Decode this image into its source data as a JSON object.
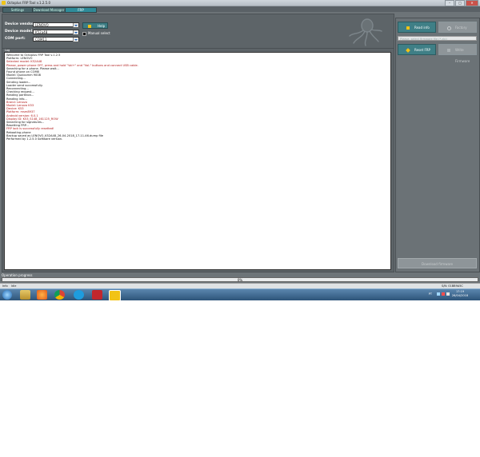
{
  "window": {
    "title": "Octoplus FRP Tool v.1.2.5.0",
    "min": "–",
    "max": "□",
    "close": "✕"
  },
  "tabs": [
    "Settings",
    "Download Manager",
    "FRP"
  ],
  "config": {
    "vendor_label": "Device vendor:",
    "vendor_value": "LENOVO",
    "model_label": "Device model:",
    "model_value": "K52a48",
    "port_label": "COM port:",
    "port_value": "COM11",
    "help_label": "Help",
    "manual_label": "Manual select"
  },
  "log": {
    "label": "Log",
    "lines": [
      {
        "text": "Welcome to Octoplus FRP Tool v.1.2.5",
        "color": "#111111"
      },
      {
        "text": "Platform: LENOVO",
        "color": "#111111"
      },
      {
        "text": "Selected model: K52A48",
        "color": "#b01818"
      },
      {
        "text": "Please, power phone OFF, press and hold \"Vol+\" and \"Vol-\" buttons and connect USB cable.",
        "color": "#b01818"
      },
      {
        "text": "Searching for a phone. Please wait...",
        "color": "#111111"
      },
      {
        "text": "Found phone on COM8",
        "color": "#111111"
      },
      {
        "text": "Model: Qualcomm 9008",
        "color": "#111111"
      },
      {
        "text": "Connecting...",
        "color": "#111111"
      },
      {
        "text": "Sending loader...",
        "color": "#111111"
      },
      {
        "text": "Loader send successfully.",
        "color": "#111111"
      },
      {
        "text": "Reconnecting...",
        "color": "#111111"
      },
      {
        "text": "Checking request...",
        "color": "#111111"
      },
      {
        "text": "Reading partition...",
        "color": "#111111"
      },
      {
        "text": "Reading info...",
        "color": "#111111"
      },
      {
        "text": "Brand: Lenovo",
        "color": "#b01818"
      },
      {
        "text": "Model: Lenovo K53",
        "color": "#b01818"
      },
      {
        "text": "Device: K53",
        "color": "#b01818"
      },
      {
        "text": "Platform: msm8937",
        "color": "#b01818"
      },
      {
        "text": "Android version: 6.0.1",
        "color": "#b01818"
      },
      {
        "text": "Display ID: K53_S148_161125_ROW",
        "color": "#b01818"
      },
      {
        "text": "Searching for signatures...",
        "color": "#111111"
      },
      {
        "text": "Resetting FRP...",
        "color": "#111111"
      },
      {
        "text": "FRP lock is successfully resetted!",
        "color": "#b01818"
      },
      {
        "text": "Rebooting phone",
        "color": "#111111"
      },
      {
        "text": "Backup saved as LENOVO_K52A48_26-04-2018_17-11-46.dump file",
        "color": "#111111"
      },
      {
        "text": "Performed by 1.2.5.0 Software version.",
        "color": "#111111"
      }
    ]
  },
  "right": {
    "read_info": "Read info",
    "factory": "Factory",
    "firmware_placeholder": "Please, select firmware file (*.zip)",
    "reset_frp": "Reset FRP",
    "write_firmware": "Write Firmware",
    "download": "Download firmware"
  },
  "progress": {
    "label": "Operation progress",
    "value": "0%",
    "fraction": 0
  },
  "status": {
    "left": "Info",
    "idle": "Idle",
    "serial": "S/N: 01BB9A5C"
  },
  "taskbar": {
    "lang": "PT",
    "time": "17:19",
    "date": "26/04/2018"
  },
  "colors": {
    "accent": "#3f7f86",
    "panel": "#5d6468",
    "log_red": "#b01818"
  }
}
